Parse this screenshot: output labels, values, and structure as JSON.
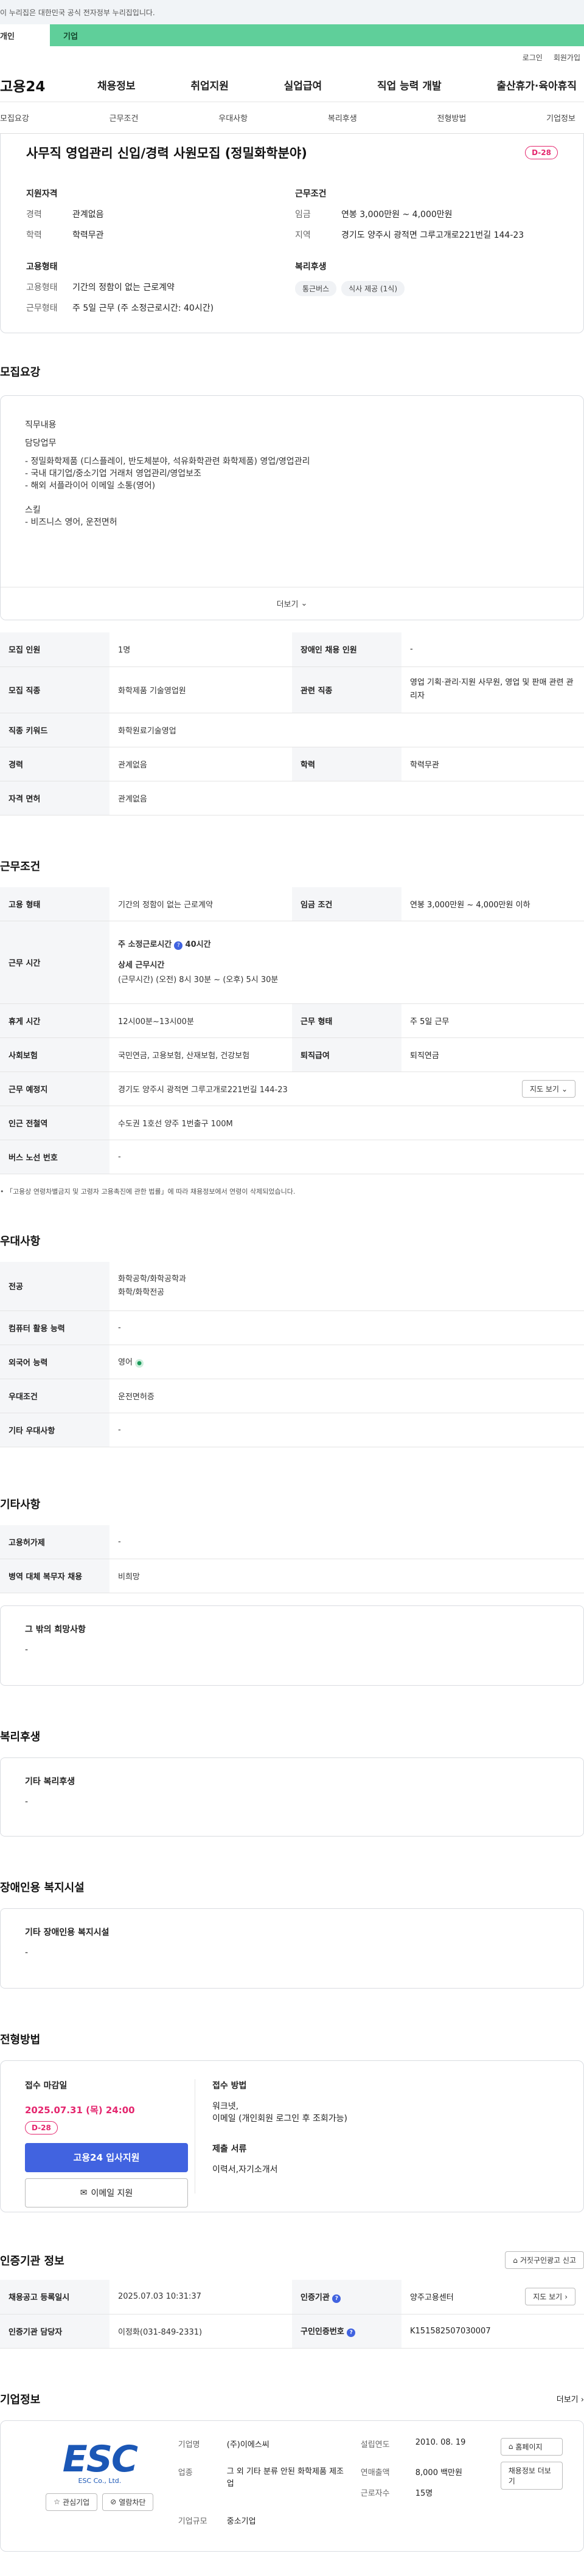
{
  "gov_banner": "이 누리집은 대한민국 공식 전자정부 누리집입니다.",
  "audience_tabs": [
    "개인",
    "기업"
  ],
  "util_links": [
    "로그인",
    "회원가입"
  ],
  "logo": "고용24",
  "gnb": [
    "채용정보",
    "취업지원",
    "실업급여",
    "직업 능력 개발",
    "출산휴가·육아휴직"
  ],
  "anchors": [
    "모집요강",
    "근무조건",
    "우대사항",
    "복리후생",
    "전형방법",
    "기업정보"
  ],
  "job": {
    "title": "사무직 영업관리 신입/경력 사원모집 (정밀화학분야)",
    "dday": "D-28",
    "qual_h": "지원자격",
    "career_k": "경력",
    "career_v": "관계없음",
    "edu_k": "학력",
    "edu_v": "학력무관",
    "cond_h": "근무조건",
    "wage_k": "임금",
    "wage_v": "연봉 3,000만원 ~ 4,000만원",
    "loc_k": "지역",
    "loc_v": "경기도 양주시 광적면 그루고개로221번길 144-23",
    "emp_h": "고용형태",
    "emptype_k": "고용형태",
    "emptype_v": "기간의 정함이 없는 근로계약",
    "worktype_k": "근무형태",
    "worktype_v": "주 5일 근무 (주 소정근로시간: 40시간)",
    "welfare_h": "복리후생",
    "chips": [
      "통근버스",
      "식사 제공 (1식)"
    ]
  },
  "recruit": {
    "title": "모집요강",
    "duty_lines": [
      "직무내용",
      "",
      "담당업무",
      "",
      "- 정밀화학제품 (디스플레이, 반도체분야, 석유화학관련 화학제품) 영업/영업관리",
      "- 국내 대기업/중소기업 거래처 영업관리/영업보조",
      "- 해외 서플라이어 이메일 소통(영어)",
      "",
      "",
      "스킬",
      "- 비즈니스 영어, 운전면허"
    ],
    "more": "더보기",
    "rows": [
      [
        "모집 인원",
        "1명",
        "장애인 채용 인원",
        "-"
      ],
      [
        "모집 직종",
        "화학제품 기술영업원",
        "관련 직종",
        "영업 기획·관리·지원 사무원, 영업 및 판매 관련 관리자"
      ],
      [
        "직종 키워드",
        "화학원료기술영업",
        "",
        ""
      ],
      [
        "경력",
        "관계없음",
        "학력",
        "학력무관"
      ],
      [
        "자격 면허",
        "관계없음",
        "",
        ""
      ]
    ]
  },
  "conditions": {
    "title": "근무조건",
    "emp_k": "고용 형태",
    "emp_v": "기간의 정함이 없는 근로계약",
    "wage_k": "임금 조건",
    "wage_v": "연봉 3,000만원 ~ 4,000만원 이하",
    "time_k": "근무 시간",
    "time_l1": "주 소정근로시간",
    "time_l1b": "40시간",
    "time_l2": "상세 근무시간",
    "time_l3": "(근무시간) (오전) 8시 30분 ~ (오후) 5시 30분",
    "rest_k": "휴게 시간",
    "rest_v": "12시00분~13시00분",
    "form_k": "근무 형태",
    "form_v": "주 5일 근무",
    "ins_k": "사회보험",
    "ins_v": "국민연금, 고용보험, 산재보험, 건강보험",
    "retire_k": "퇴직급여",
    "retire_v": "퇴직연금",
    "place_k": "근무 예정지",
    "place_v": "경기도 양주시 광적면 그루고개로221번길 144-23",
    "map_btn": "지도 보기",
    "subway_k": "인근 전철역",
    "subway_v": "수도권 1호선 양주 1번출구 100M",
    "bus_k": "버스 노선 번호",
    "bus_v": "-",
    "note": "「고용상 연령차별금지 및 고령자 고용촉진에 관한 법률」에 따라 채용정보에서 연령이 삭제되었습니다."
  },
  "pref": {
    "title": "우대사항",
    "rows": [
      [
        "전공",
        "화학공학/화학공학과\n화학/화학전공"
      ],
      [
        "컴퓨터 활용 능력",
        "-"
      ],
      [
        "외국어 능력",
        "영어"
      ],
      [
        "우대조건",
        "운전면허증"
      ],
      [
        "기타 우대사항",
        "-"
      ]
    ]
  },
  "etc": {
    "title": "기타사항",
    "rows": [
      [
        "고용허가제",
        "-"
      ],
      [
        "병역 대체 복무자 채용",
        "비희망"
      ]
    ],
    "box_h": "그 밖의 희망사항",
    "box_v": "-"
  },
  "welfare": {
    "title": "복리후생",
    "box_h": "기타 복리후생",
    "box_v": "-"
  },
  "disability": {
    "title": "장애인용 복지시설",
    "box_h": "기타 장애인용 복지시설",
    "box_v": "-"
  },
  "selection": {
    "title": "전형방법",
    "deadline_h": "접수 마감일",
    "deadline": "2025.07.31 (목) 24:00",
    "dday": "D-28",
    "apply_btn": "고용24 입사지원",
    "email_btn": "이메일 지원",
    "method_h": "접수 방법",
    "method_v1": "워크넷,",
    "method_v2": "이메일 (개인회원 로그인 후 조회가능)",
    "docs_h": "제출 서류",
    "docs_v": "이력서,자기소개서"
  },
  "cert": {
    "title": "인증기관 정보",
    "report_btn": "거짓구인광고 신고",
    "reg_k": "채용공고 등록일시",
    "reg_v": "2025.07.03 10:31:37",
    "org_k": "인증기관",
    "org_v": "양주고용센터",
    "map_btn": "지도 보기",
    "mgr_k": "인증기관 담당자",
    "mgr_v": "이정화(031-849-2331)",
    "num_k": "구인인증번호",
    "num_v": "K151582507030007"
  },
  "company": {
    "title": "기업정보",
    "more": "더보기",
    "logo_text": "ESC",
    "logo_sub": "ESC Co., Ltd.",
    "fav_btn": "관심기업",
    "block_btn": "열람차단",
    "name_k": "기업명",
    "name_v": "(주)이에스씨",
    "found_k": "설립연도",
    "found_v": "2010. 08. 19",
    "ind_k": "업종",
    "ind_v": "그 외 기타 분류 안된 화학제품 제조업",
    "sales_k": "연매출액",
    "sales_v": "8,000 백만원",
    "emp_k": "근로자수",
    "emp_v": "15명",
    "size_k": "기업규모",
    "size_v": "중소기업",
    "home_btn": "홈페이지",
    "list_btn": "채용정보 더보기"
  }
}
